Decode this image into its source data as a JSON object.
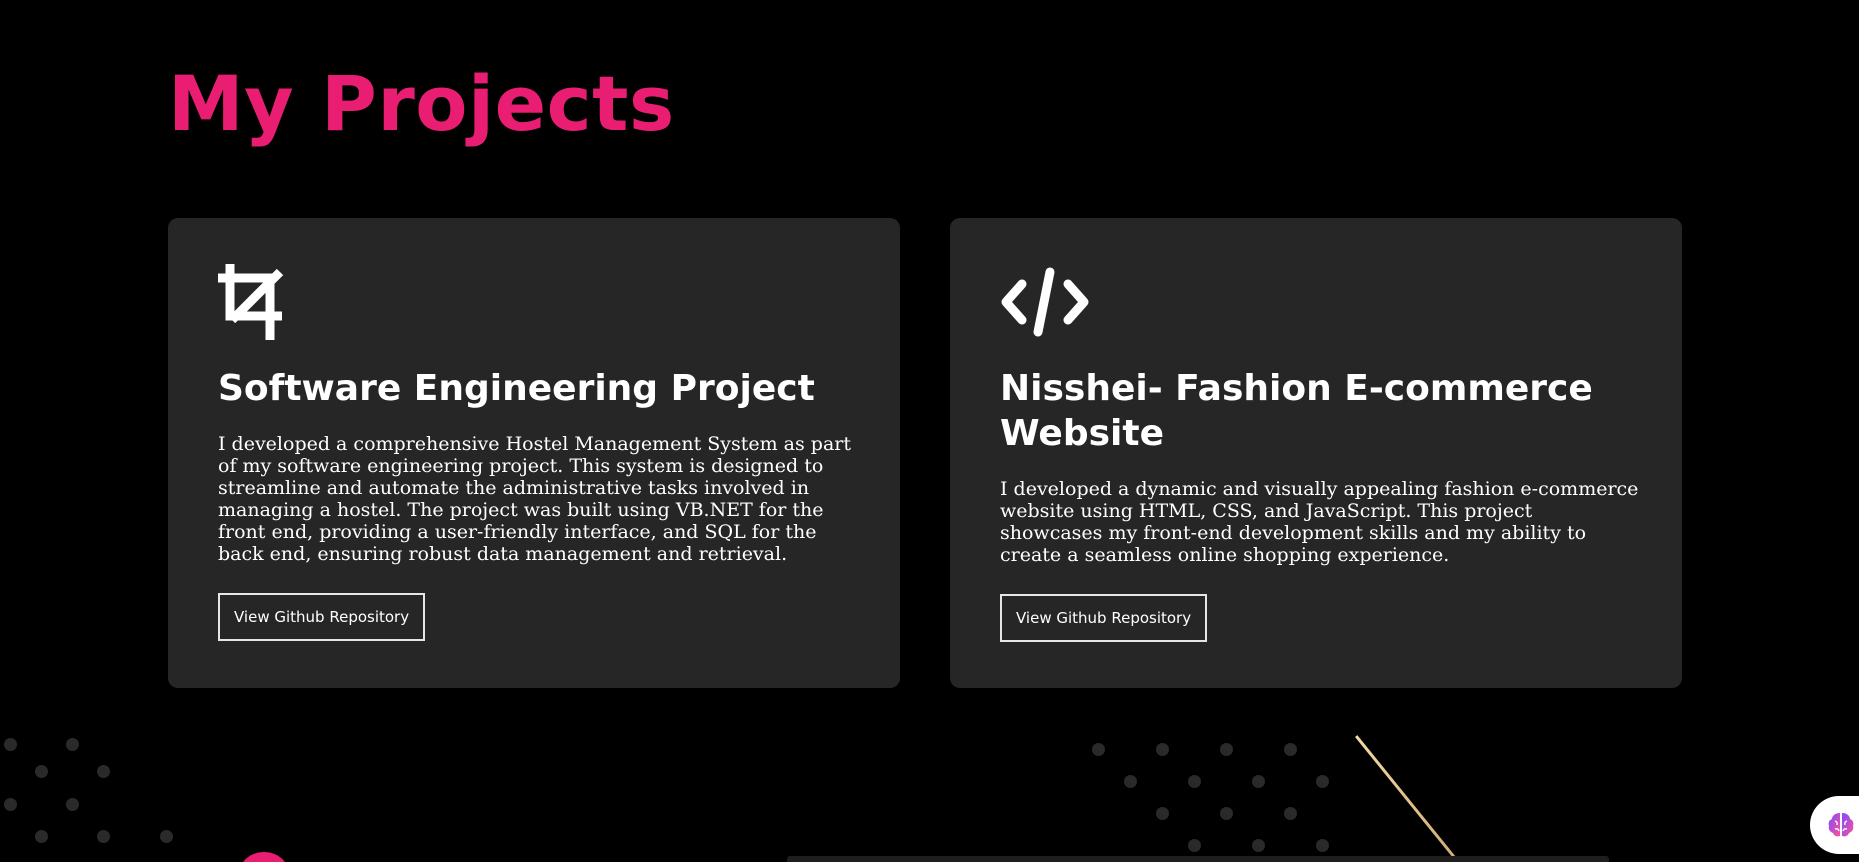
{
  "section": {
    "title": "My Projects"
  },
  "projects": [
    {
      "icon": "crop-icon",
      "title": "Software Engineering Project",
      "description": "I developed a comprehensive Hostel Management System as part of my software engineering project. This system is designed to streamline and automate the administrative tasks involved in managing a hostel. The project was built using VB.NET for the front end, providing a user-friendly interface, and SQL for the back end, ensuring robust data management and retrieval.",
      "button_label": "View Github Repository"
    },
    {
      "icon": "code-icon",
      "title": "Nisshei- Fashion E-commerce Website",
      "description": "I developed a dynamic and visually appealing fashion e-commerce website using HTML, CSS, and JavaScript. This project showcases my front-end development skills and my ability to create a seamless online shopping experience.",
      "button_label": "View Github Repository"
    }
  ],
  "widget": {
    "icon": "brain-icon"
  },
  "colors": {
    "accent": "#e91e73",
    "background": "#000000",
    "card": "#262626",
    "text": "#ffffff",
    "decor_line": "#d9b57e"
  }
}
